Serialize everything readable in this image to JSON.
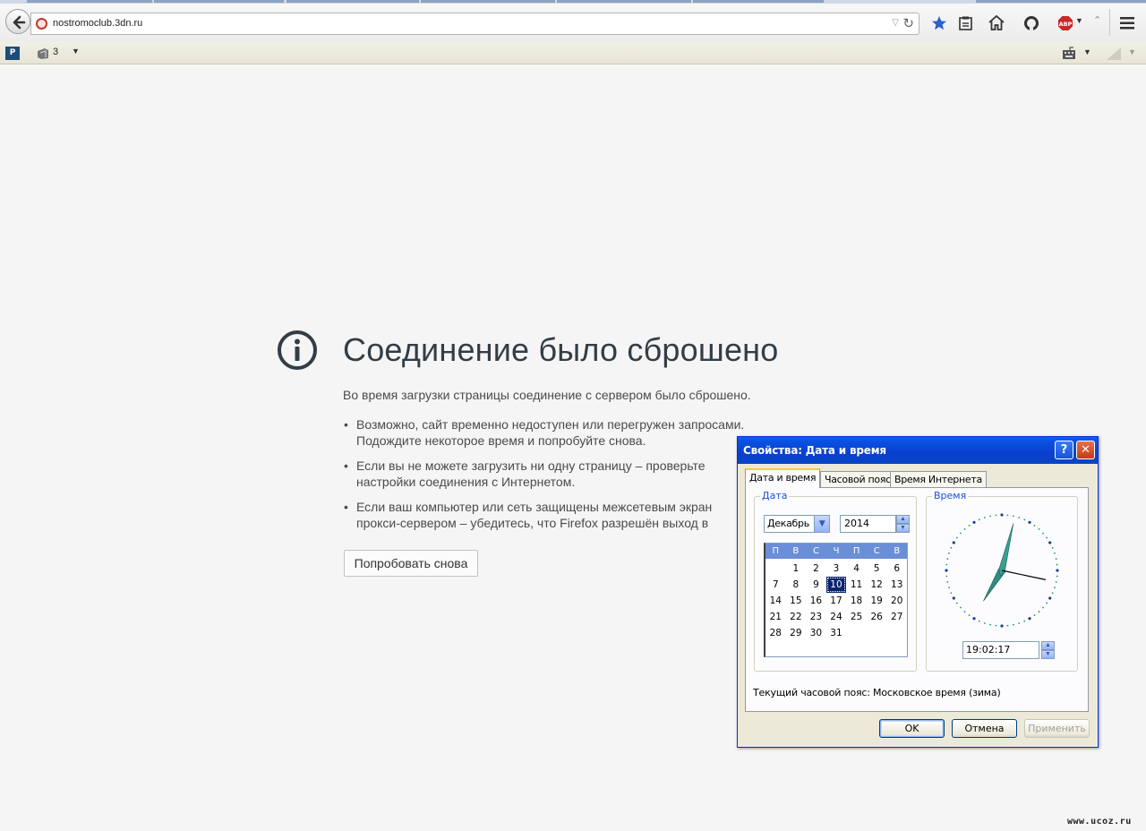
{
  "browser": {
    "url": "nostromoclub.3dn.ru",
    "bookmarks_bar": {
      "count": "3"
    }
  },
  "error_page": {
    "title": "Соединение было сброшено",
    "description": "Во время загрузки страницы соединение с сервером было сброшено.",
    "bullets": [
      {
        "line1": "Возможно, сайт временно недоступен или перегружен запросами.",
        "line2": "Подождите некоторое время и попробуйте снова."
      },
      {
        "line1": "Если вы не можете загрузить ни одну страницу – проверьте",
        "line2": "настройки соединения с Интернетом."
      },
      {
        "line1": "Если ваш компьютер или сеть защищены межсетевым экран",
        "line2": "прокси-сервером – убедитесь, что Firefox разрешён выход в"
      }
    ],
    "retry_label": "Попробовать снова"
  },
  "dialog": {
    "title": "Свойства: Дата и время",
    "help_label": "?",
    "close_label": "✕",
    "tabs": [
      {
        "label": "Дата и время",
        "active": true
      },
      {
        "label": "Часовой пояс",
        "active": false
      },
      {
        "label": "Время Интернета",
        "active": false
      }
    ],
    "date_group_label": "Дата",
    "time_group_label": "Время",
    "month": "Декабрь",
    "year": "2014",
    "weekdays": [
      "П",
      "В",
      "С",
      "Ч",
      "П",
      "С",
      "В"
    ],
    "calendar_days": [
      "",
      "1",
      "2",
      "3",
      "4",
      "5",
      "6",
      "7",
      "8",
      "9",
      "10",
      "11",
      "12",
      "13",
      "14",
      "15",
      "16",
      "17",
      "18",
      "19",
      "20",
      "21",
      "22",
      "23",
      "24",
      "25",
      "26",
      "27",
      "28",
      "29",
      "30",
      "31",
      "",
      "",
      "",
      ""
    ],
    "selected_day": "10",
    "time": "19:02:17",
    "timezone_text": "Текущий часовой пояс: Московское время (зима)",
    "buttons": {
      "ok": "OK",
      "cancel": "Отмена",
      "apply": "Применить"
    }
  },
  "watermark": "www.ucoz.ru",
  "colors": {
    "dialog_title_bar": "#0a52e0",
    "calendar_header": "#6b8ed8",
    "error_title": "#333d46",
    "page_background": "#f5f5f5"
  }
}
